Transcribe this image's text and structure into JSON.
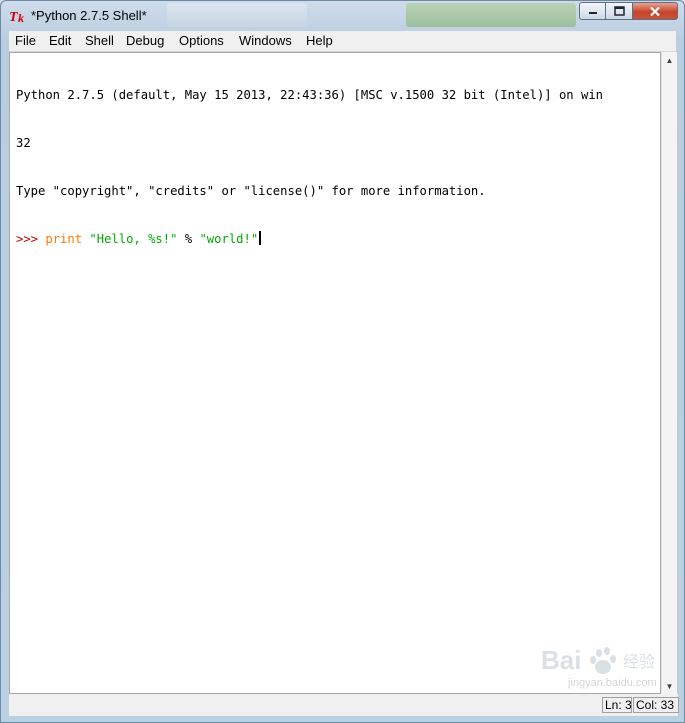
{
  "window": {
    "title": "*Python 2.7.5 Shell*"
  },
  "menu": {
    "items": [
      "File",
      "Edit",
      "Shell",
      "Debug",
      "Options",
      "Windows",
      "Help"
    ]
  },
  "editor": {
    "banner_line1": "Python 2.7.5 (default, May 15 2013, 22:43:36) [MSC v.1500 32 bit (Intel)] on win",
    "banner_line2": "32",
    "banner_line3": "Type \"copyright\", \"credits\" or \"license()\" for more information.",
    "prompt": ">>> ",
    "code_keyword": "print",
    "code_string1": "\"Hello, %s!\"",
    "code_operator": " % ",
    "code_string2": "\"world!\""
  },
  "status": {
    "line": "Ln: 3",
    "column": "Col: 33"
  },
  "watermark": {
    "text": "jingyan.baidu.com"
  },
  "colors": {
    "keyword": "#ff7700",
    "string": "#00aa00",
    "prompt": "#c00000"
  }
}
